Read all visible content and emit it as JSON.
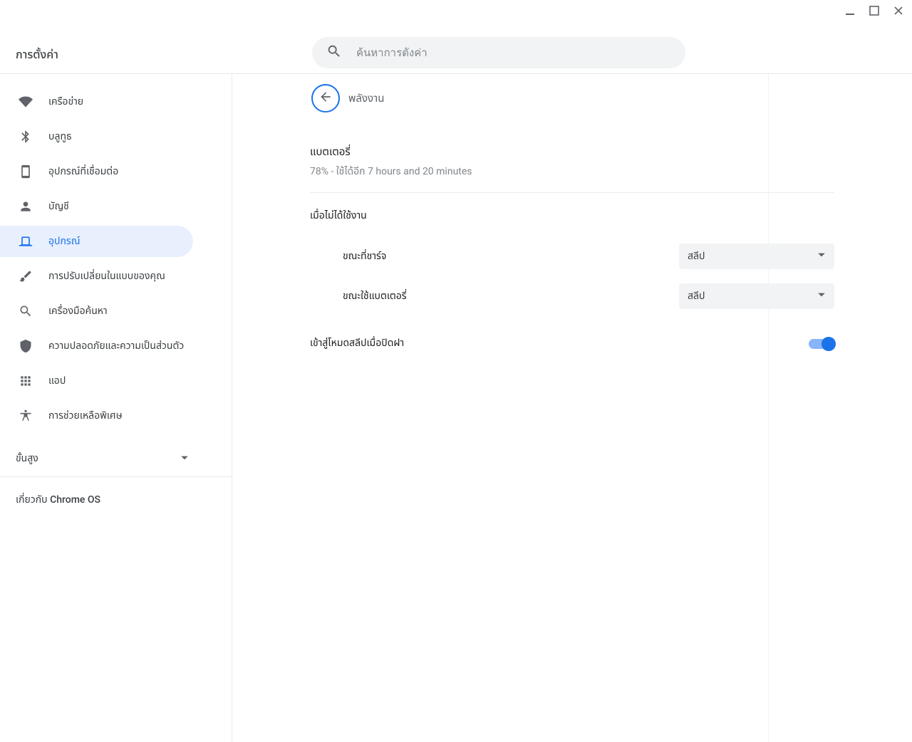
{
  "window": {
    "title": "การตั้งค่า"
  },
  "search": {
    "placeholder": "ค้นหาการตั้งค่า"
  },
  "sidebar": {
    "items": [
      {
        "label": "เครือข่าย",
        "icon": "wifi"
      },
      {
        "label": "บลูทูธ",
        "icon": "bluetooth"
      },
      {
        "label": "อุปกรณ์ที่เชื่อมต่อ",
        "icon": "phone"
      },
      {
        "label": "บัญชี",
        "icon": "person"
      },
      {
        "label": "อุปกรณ์",
        "icon": "laptop",
        "active": true
      },
      {
        "label": "การปรับเปลี่ยนในแบบของคุณ",
        "icon": "brush"
      },
      {
        "label": "เครื่องมือค้นหา",
        "icon": "search"
      },
      {
        "label": "ความปลอดภัยและความเป็นส่วนตัว",
        "icon": "shield"
      },
      {
        "label": "แอป",
        "icon": "apps"
      },
      {
        "label": "การช่วยเหลือพิเศษ",
        "icon": "accessibility"
      }
    ],
    "advanced_label": "ขั้นสูง",
    "about_prefix": "เกี่ยวกับ ",
    "about_product": "Chrome OS"
  },
  "main": {
    "page_title": "พลังงาน",
    "battery_heading": "แบตเตอรี่",
    "battery_status": "78% - ใช้ได้อีก 7 hours and 20 minutes",
    "idle_heading": "เมื่อไม่ได้ใช้งาน",
    "charging_label": "ขณะที่ชาร์จ",
    "charging_value": "สลีป",
    "battery_label": "ขณะใช้แบตเตอรี่",
    "battery_value": "สลีป",
    "lid_sleep_label": "เข้าสู่โหมดสลีปเมื่อปิดฝา",
    "lid_sleep_on": true
  }
}
